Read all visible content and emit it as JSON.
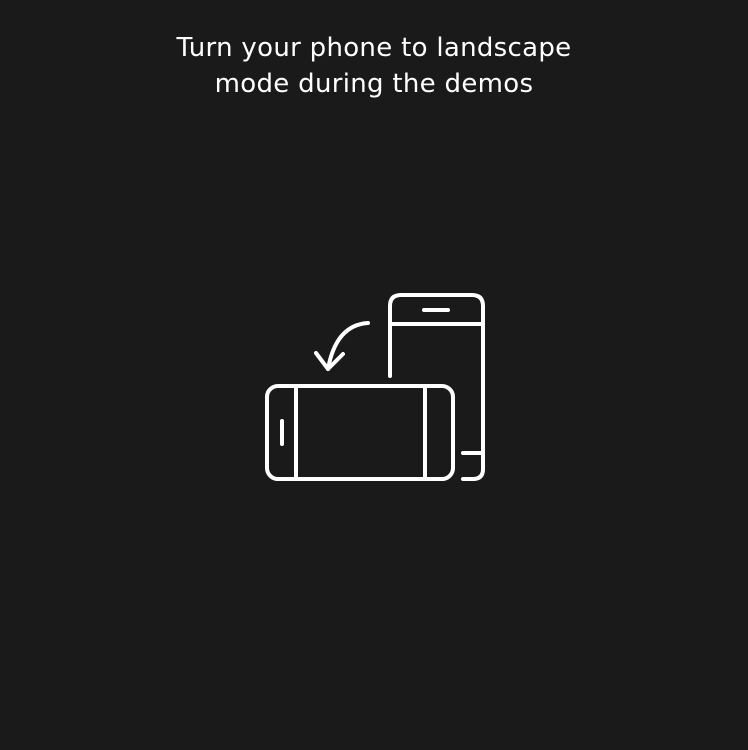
{
  "rotate_prompt": {
    "line1": "Turn your phone to landscape",
    "line2": "mode during the demos",
    "icon": "rotate-phone-icon"
  },
  "colors": {
    "background": "#1a1a1a",
    "foreground": "#ffffff"
  }
}
